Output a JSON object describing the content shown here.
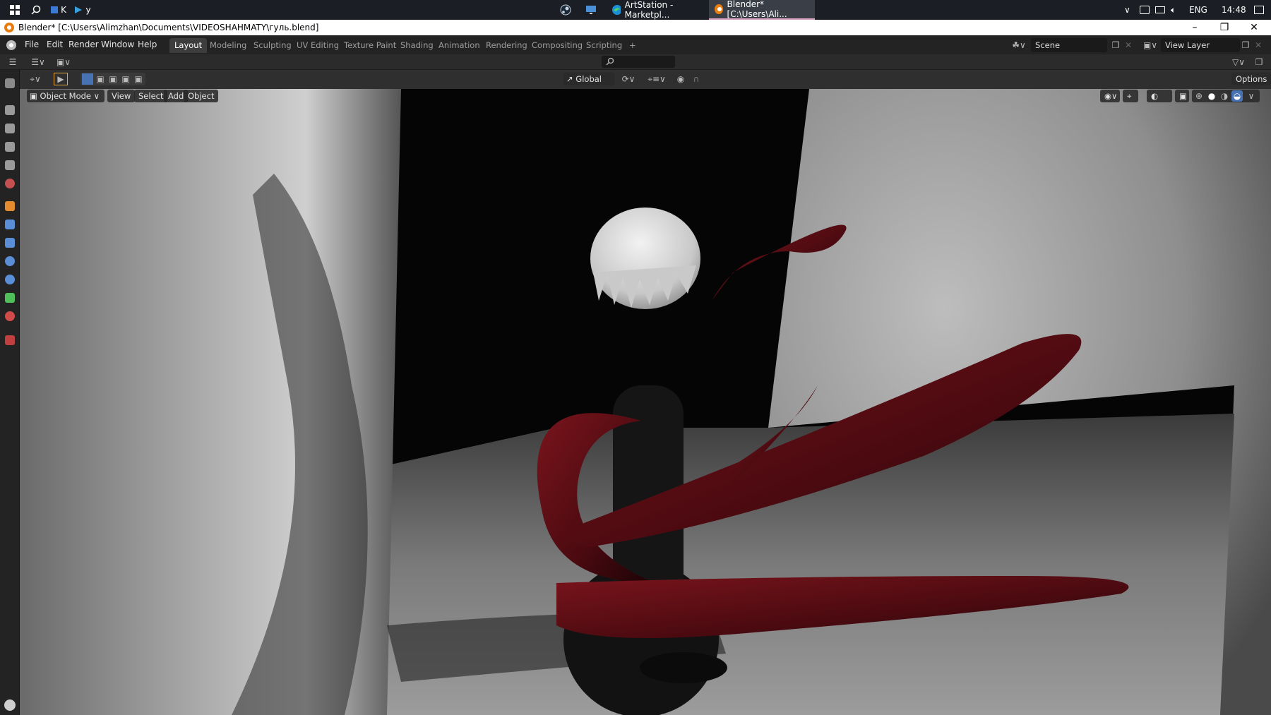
{
  "taskbar": {
    "pinned": [
      {
        "icon": "windows-start-icon"
      },
      {
        "icon": "search-icon"
      },
      {
        "icon": "app-k-icon",
        "label": "K"
      },
      {
        "icon": "app-y-icon",
        "label": "y"
      }
    ],
    "tasks": [
      {
        "icon": "steam-icon"
      },
      {
        "icon": "desktop-icon"
      },
      {
        "icon": "edge-icon",
        "label": "ArtStation - Marketpl..."
      },
      {
        "icon": "blender-icon",
        "label": "Blender* [C:\\Users\\Ali..."
      }
    ],
    "tray": {
      "lang": "ENG",
      "time": "14:48"
    }
  },
  "window": {
    "title": "Blender* [C:\\Users\\Alimzhan\\Documents\\VIDEOSHAHMATY\\гуль.blend]"
  },
  "menu": {
    "items": [
      "File",
      "Edit",
      "Render",
      "Window",
      "Help"
    ]
  },
  "workspaces": {
    "tabs": [
      "Layout",
      "Modeling",
      "Sculpting",
      "UV Editing",
      "Texture Paint",
      "Shading",
      "Animation",
      "Rendering",
      "Compositing",
      "Scripting"
    ],
    "active": "Layout",
    "add_label": "+"
  },
  "scene": {
    "name": "Scene",
    "view_layer": "View Layer"
  },
  "toolbar": {
    "orientation": "Global",
    "options_label": "Options"
  },
  "viewport_header": {
    "mode": "Object Mode",
    "menus": [
      "View",
      "Select",
      "Add",
      "Object"
    ]
  },
  "colors": {
    "accent": "#4772b3",
    "tab_active": "#3d3d3d",
    "creature_red": "#5a0d14",
    "bg": "#232323"
  }
}
